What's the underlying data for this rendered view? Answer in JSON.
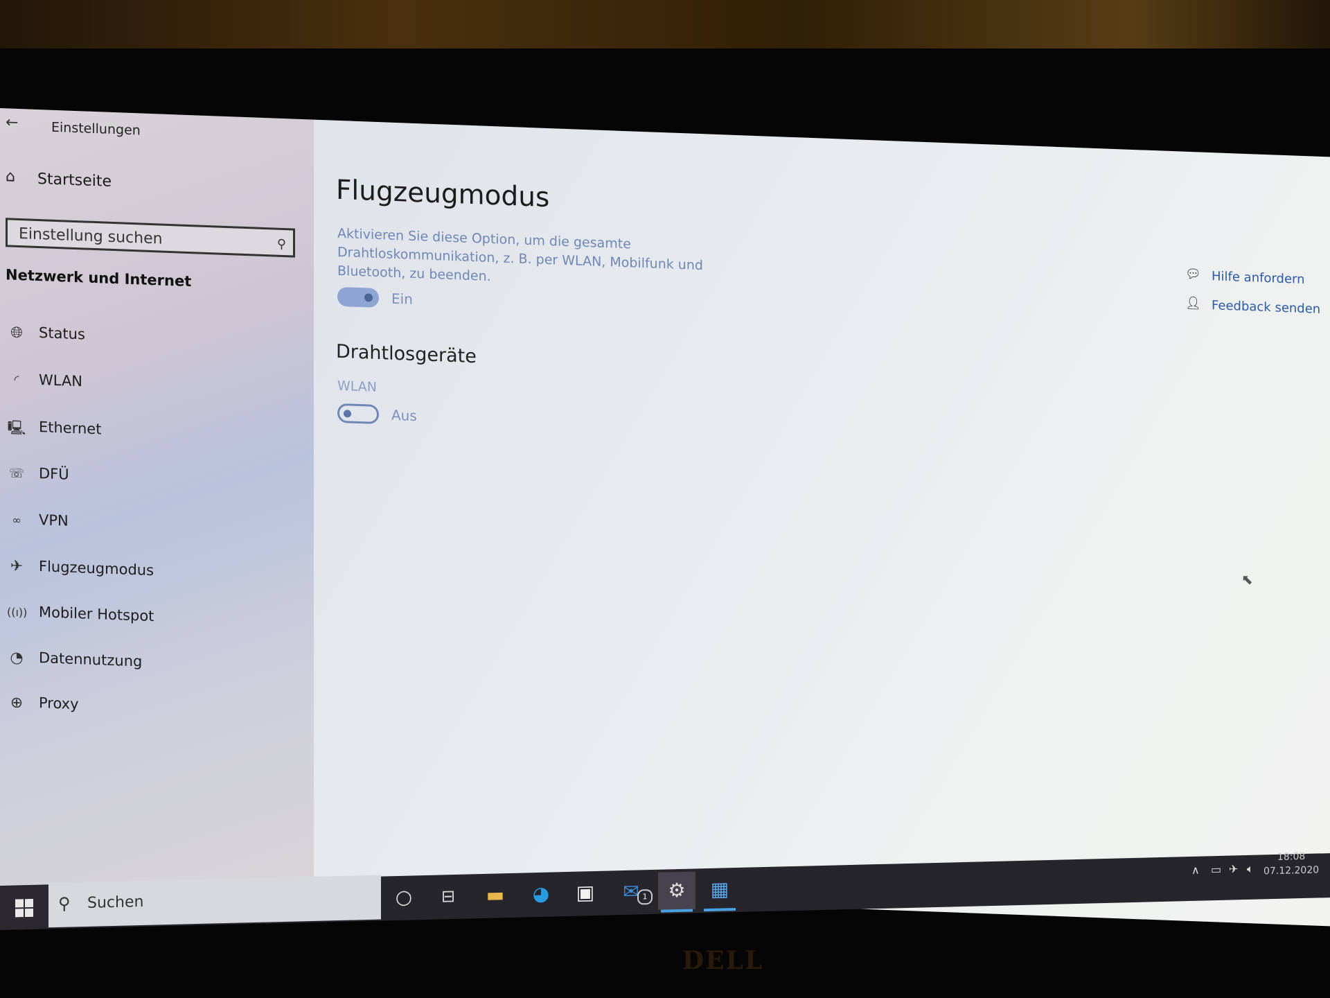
{
  "window": {
    "title": "Einstellungen",
    "back_icon": "arrow-left-icon"
  },
  "sidebar": {
    "home_label": "Startseite",
    "home_icon": "home-icon",
    "search_placeholder": "Einstellung suchen",
    "search_icon": "search-icon",
    "section_title": "Netzwerk und Internet",
    "items": [
      {
        "label": "Status",
        "icon": "globe-status-icon"
      },
      {
        "label": "WLAN",
        "icon": "wifi-icon"
      },
      {
        "label": "Ethernet",
        "icon": "ethernet-icon"
      },
      {
        "label": "DFÜ",
        "icon": "dial-up-icon"
      },
      {
        "label": "VPN",
        "icon": "vpn-icon"
      },
      {
        "label": "Flugzeugmodus",
        "icon": "airplane-icon"
      },
      {
        "label": "Mobiler Hotspot",
        "icon": "hotspot-icon"
      },
      {
        "label": "Datennutzung",
        "icon": "data-usage-icon"
      },
      {
        "label": "Proxy",
        "icon": "globe-icon"
      }
    ]
  },
  "main": {
    "title": "Flugzeugmodus",
    "description": "Aktivieren Sie diese Option, um die gesamte Drahtloskommunikation, z. B. per WLAN, Mobilfunk und Bluetooth, zu beenden.",
    "airplane_toggle": {
      "state": "on",
      "label": "Ein"
    },
    "wireless_heading": "Drahtlosgeräte",
    "wlan": {
      "label": "WLAN",
      "state": "off",
      "toggle_label": "Aus"
    },
    "links": [
      {
        "label": "Hilfe anfordern",
        "icon": "help-chat-icon"
      },
      {
        "label": "Feedback senden",
        "icon": "feedback-icon"
      }
    ]
  },
  "taskbar": {
    "search_placeholder": "Suchen",
    "apps": [
      {
        "name": "cortana",
        "icon": "cortana-circle-icon"
      },
      {
        "name": "task-view",
        "icon": "task-view-icon"
      },
      {
        "name": "file-explorer",
        "icon": "folder-icon"
      },
      {
        "name": "edge",
        "icon": "edge-icon"
      },
      {
        "name": "store",
        "icon": "store-bag-icon"
      },
      {
        "name": "mail",
        "icon": "mail-icon",
        "badge": "1"
      },
      {
        "name": "settings",
        "icon": "gear-icon",
        "active": true
      },
      {
        "name": "calculator",
        "icon": "calculator-icon"
      }
    ],
    "tray": {
      "time": "18:08",
      "date": "07.12.2020"
    }
  },
  "brand": {
    "bezel_logo": "DELL"
  },
  "colors": {
    "accent": "#2b5aa8",
    "toggle_on": "#8ea5d4",
    "description_text": "#6f87b4",
    "taskbar": "#26252c"
  }
}
